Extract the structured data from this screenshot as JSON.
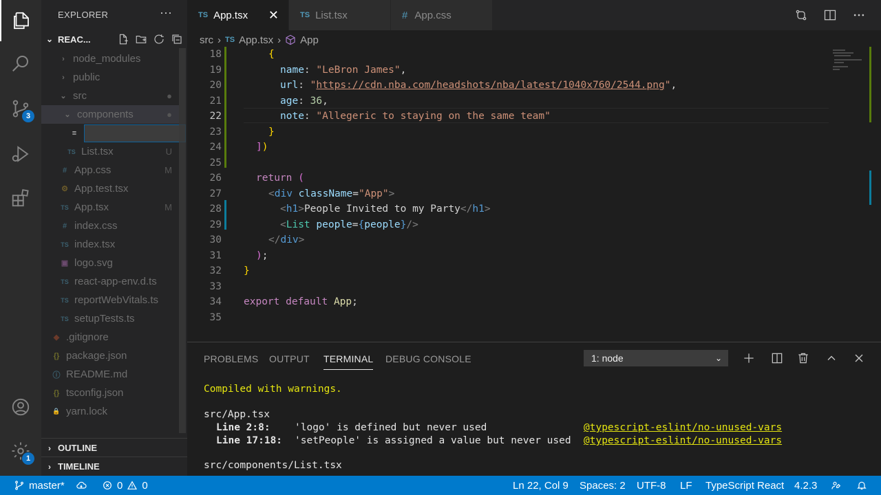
{
  "colors": {
    "accent": "#007acc",
    "badge": "#0e70c0",
    "ts_icon": "#519aba",
    "git_added": "#587c0c",
    "git_modified": "#0c7d9d",
    "terminal_warning": "#e5e510"
  },
  "activity_bar": {
    "items": [
      "explorer-icon",
      "search-icon",
      "source-control-icon",
      "run-debug-icon",
      "extensions-icon"
    ],
    "source_control_badge": "3",
    "settings_badge": "1"
  },
  "sidebar": {
    "title": "EXPLORER",
    "more": "···",
    "project": "REAC...",
    "tree": [
      {
        "label": "node_modules",
        "icon": "›",
        "status": ""
      },
      {
        "label": "public",
        "icon": "›",
        "status": ""
      },
      {
        "label": "src",
        "icon": "⌄",
        "status": "●"
      },
      {
        "label": "components",
        "icon": "⌄",
        "status": "●"
      },
      {
        "label": "",
        "icon": "≡",
        "status": ""
      },
      {
        "label": "List.tsx",
        "icon": "TS",
        "status": "U"
      },
      {
        "label": "App.css",
        "icon": "#",
        "status": "M"
      },
      {
        "label": "App.test.tsx",
        "icon": "⚙",
        "status": ""
      },
      {
        "label": "App.tsx",
        "icon": "TS",
        "status": "M"
      },
      {
        "label": "index.css",
        "icon": "#",
        "status": ""
      },
      {
        "label": "index.tsx",
        "icon": "TS",
        "status": ""
      },
      {
        "label": "logo.svg",
        "icon": "▣",
        "status": ""
      },
      {
        "label": "react-app-env.d.ts",
        "icon": "TS",
        "status": ""
      },
      {
        "label": "reportWebVitals.ts",
        "icon": "TS",
        "status": ""
      },
      {
        "label": "setupTests.ts",
        "icon": "TS",
        "status": ""
      },
      {
        "label": ".gitignore",
        "icon": "◆",
        "status": ""
      },
      {
        "label": "package.json",
        "icon": "{}",
        "status": ""
      },
      {
        "label": "README.md",
        "icon": "ⓘ",
        "status": ""
      },
      {
        "label": "tsconfig.json",
        "icon": "{}",
        "status": ""
      },
      {
        "label": "yarn.lock",
        "icon": "🔒",
        "status": ""
      }
    ],
    "outline": "OUTLINE",
    "timeline": "TIMELINE"
  },
  "tabs": [
    {
      "label": "App.tsx",
      "kind": "TS",
      "active": true
    },
    {
      "label": "List.tsx",
      "kind": "TS",
      "active": false
    },
    {
      "label": "App.css",
      "kind": "#",
      "active": false
    }
  ],
  "breadcrumb": {
    "folder": "src",
    "file": "App.tsx",
    "symbol": "App",
    "ts": "TS"
  },
  "editor": {
    "current_line": 22,
    "lines": [
      {
        "n": "18",
        "text": "{"
      },
      {
        "n": "19",
        "text": "name: \"LeBron James\","
      },
      {
        "n": "20",
        "text": "url: \"https://cdn.nba.com/headshots/nba/latest/1040x760/2544.png\","
      },
      {
        "n": "21",
        "text": "age: 36,"
      },
      {
        "n": "22",
        "text": "note: \"Allegeric to staying on the same team\""
      },
      {
        "n": "23",
        "text": "}"
      },
      {
        "n": "24",
        "text": "])"
      },
      {
        "n": "25",
        "text": ""
      },
      {
        "n": "26",
        "text": "return ("
      },
      {
        "n": "27",
        "text": "<div className=\"App\">"
      },
      {
        "n": "28",
        "text": "<h1>People Invited to my Party</h1>"
      },
      {
        "n": "29",
        "text": "<List people={people}/>"
      },
      {
        "n": "30",
        "text": "</div>"
      },
      {
        "n": "31",
        "text": ");"
      },
      {
        "n": "32",
        "text": "}"
      },
      {
        "n": "33",
        "text": ""
      },
      {
        "n": "34",
        "text": "export default App;"
      },
      {
        "n": "35",
        "text": ""
      }
    ]
  },
  "panel": {
    "tabs": [
      "PROBLEMS",
      "OUTPUT",
      "TERMINAL",
      "DEBUG CONSOLE"
    ],
    "active_tab": "TERMINAL",
    "terminal_select": "1: node",
    "terminal": {
      "compiled": "Compiled with warnings.",
      "file1": "src/App.tsx",
      "w1_loc": "Line 2:8:",
      "w1_msg": "'logo' is defined but never used",
      "w1_rule": "@typescript-eslint/no-unused-vars",
      "w2_loc": "Line 17:18:",
      "w2_msg": "'setPeople' is assigned a value but never used",
      "w2_rule": "@typescript-eslint/no-unused-vars",
      "file2": "src/components/List.tsx"
    }
  },
  "status_bar": {
    "branch": "master*",
    "errors": "0",
    "warnings": "0",
    "position": "Ln 22, Col 9",
    "spaces": "Spaces: 2",
    "encoding": "UTF-8",
    "eol": "LF",
    "language": "TypeScript React",
    "version": "4.2.3"
  }
}
